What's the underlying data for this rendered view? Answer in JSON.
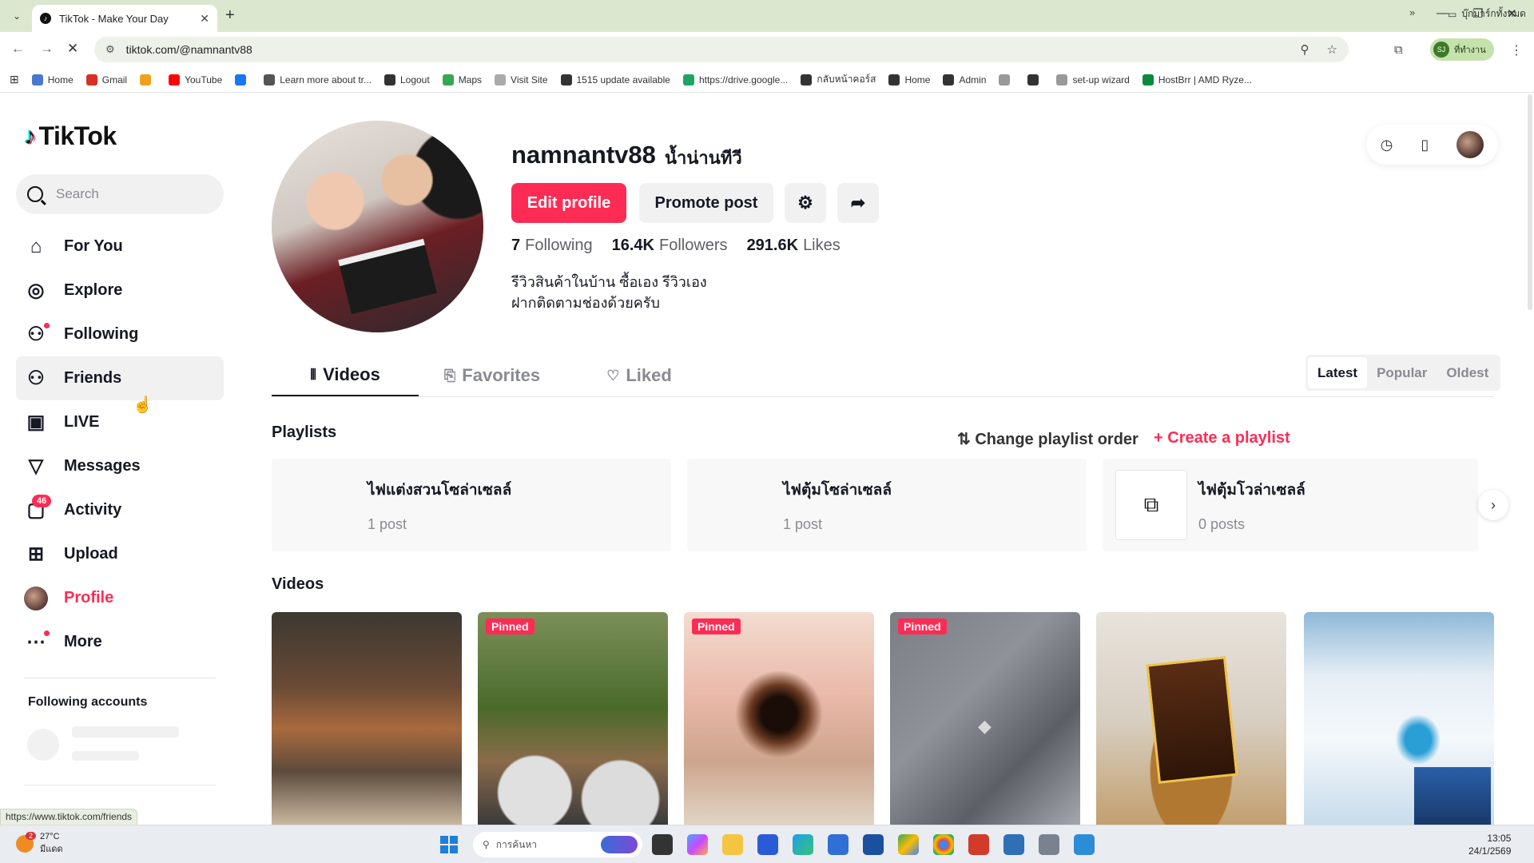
{
  "browser": {
    "tab_title": "TikTok - Make Your Day",
    "url": "tiktok.com/@namnantv88",
    "profile_name": "ที่ทำงาน",
    "profile_initials": "SJ",
    "bookmarks": [
      {
        "label": "Home",
        "color": "#4a78d0"
      },
      {
        "label": "Gmail",
        "color": "#d93025"
      },
      {
        "label": "",
        "color": "#f2a01b"
      },
      {
        "label": "YouTube",
        "color": "#ff0000"
      },
      {
        "label": "",
        "color": "#1877f2"
      },
      {
        "label": "Learn more about tr...",
        "color": "#555555"
      },
      {
        "label": "Logout",
        "color": "#333333"
      },
      {
        "label": "Maps",
        "color": "#34a853"
      },
      {
        "label": "Visit Site",
        "color": "#aaaaaa"
      },
      {
        "label": "1515 update available",
        "color": "#333333"
      },
      {
        "label": "https://drive.google...",
        "color": "#1fa463"
      },
      {
        "label": "กลับหน้าคอร์ส",
        "color": "#333333"
      },
      {
        "label": "Home",
        "color": "#333333"
      },
      {
        "label": "Admin",
        "color": "#333333"
      },
      {
        "label": "",
        "color": "#999999"
      },
      {
        "label": "",
        "color": "#333333"
      },
      {
        "label": "set-up wizard",
        "color": "#999999"
      },
      {
        "label": "HostBrr | AMD Ryze...",
        "color": "#0a8a3a"
      }
    ],
    "bookmark_folder": "บุ๊กมาร์กทั้งหมด",
    "status_url": "https://www.tiktok.com/friends"
  },
  "sidebar": {
    "logo": "TikTok",
    "search_placeholder": "Search",
    "items": [
      {
        "label": "For You",
        "icon": "home-icon",
        "glyph": "⌂"
      },
      {
        "label": "Explore",
        "icon": "compass-icon",
        "glyph": "◎"
      },
      {
        "label": "Following",
        "icon": "user-follow-icon",
        "glyph": "⚇"
      },
      {
        "label": "Friends",
        "icon": "friends-icon",
        "glyph": "⚇"
      },
      {
        "label": "LIVE",
        "icon": "live-tv-icon",
        "glyph": "▣"
      },
      {
        "label": "Messages",
        "icon": "send-icon",
        "glyph": "▽"
      },
      {
        "label": "Activity",
        "icon": "inbox-icon",
        "glyph": "▢",
        "badge": "46"
      },
      {
        "label": "Upload",
        "icon": "plus-square-icon",
        "glyph": "⊞"
      },
      {
        "label": "Profile",
        "icon": "avatar",
        "glyph": ""
      },
      {
        "label": "More",
        "icon": "more-dots-icon",
        "glyph": "⋯"
      }
    ],
    "following_accounts_title": "Following accounts"
  },
  "profile": {
    "username": "namnantv88",
    "nickname": "น้ำน่านทีวี",
    "edit_button": "Edit profile",
    "promote_button": "Promote post",
    "stats": {
      "following_count": "7",
      "following_label": "Following",
      "followers_count": "16.4K",
      "followers_label": "Followers",
      "likes_count": "291.6K",
      "likes_label": "Likes"
    },
    "bio_line1": "รีวิวสินค้าในบ้าน ซื้อเอง รีวิวเอง",
    "bio_line2": "ฝากติดตามช่องด้วยครับ"
  },
  "content_tabs": {
    "videos": "Videos",
    "favorites": "Favorites",
    "liked": "Liked"
  },
  "sort": {
    "latest": "Latest",
    "popular": "Popular",
    "oldest": "Oldest"
  },
  "playlists": {
    "title": "Playlists",
    "change_order": "Change playlist order",
    "create": "Create a playlist",
    "items": [
      {
        "name": "ไฟแต่งสวนโซล่าเซลล์",
        "count": "1 post"
      },
      {
        "name": "ไฟตุ้มโซล่าเซลล์",
        "count": "1 post"
      },
      {
        "name": "ไฟตุ้มโวล่าเซลล์",
        "count": "0 posts"
      }
    ]
  },
  "videos": {
    "title": "Videos",
    "pinned_label": "Pinned"
  },
  "taskbar": {
    "weather_temp": "27°C",
    "weather_desc": "มีแดด",
    "weather_badge": "2",
    "search_placeholder": "การค้นหา",
    "time": "13:05",
    "date": "24/1/2569"
  }
}
